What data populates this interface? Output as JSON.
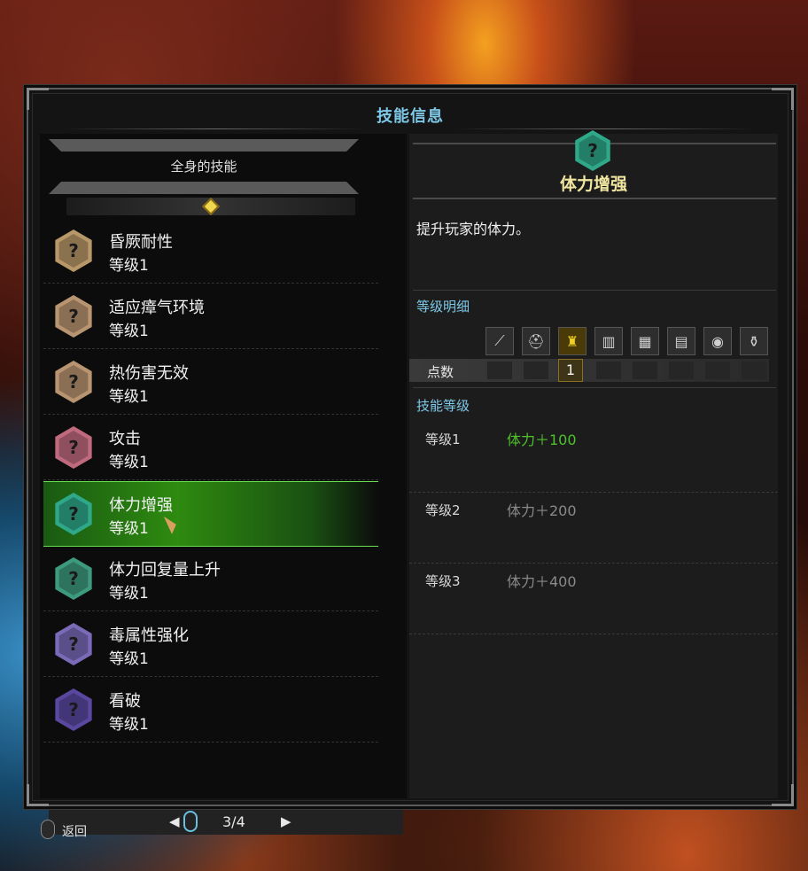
{
  "window": {
    "title": "技能信息"
  },
  "left_panel": {
    "header": "全身的技能",
    "skills": [
      {
        "name": "昏厥耐性",
        "level": "等级1",
        "color": "#b89868"
      },
      {
        "name": "适应瘴气环境",
        "level": "等级1",
        "color": "#b89470"
      },
      {
        "name": "热伤害无效",
        "level": "等级1",
        "color": "#b89470"
      },
      {
        "name": "攻击",
        "level": "等级1",
        "color": "#c06a7e"
      },
      {
        "name": "体力增强",
        "level": "等级1",
        "color": "#2fa88a",
        "selected": true
      },
      {
        "name": "体力回复量上升",
        "level": "等级1",
        "color": "#3e9a7e"
      },
      {
        "name": "毒属性强化",
        "level": "等级1",
        "color": "#7a6ab8"
      },
      {
        "name": "看破",
        "level": "等级1",
        "color": "#5a48a0"
      }
    ],
    "pager": {
      "prev": "◀",
      "next": "▶",
      "page": "3/4"
    }
  },
  "detail": {
    "skill_name": "体力增强",
    "icon_color": "#2fa88a",
    "description": "提升玩家的体力。",
    "level_detail_header": "等级明细",
    "points_label": "点数",
    "points_value": "1",
    "equipment_slots": [
      "weapon-icon",
      "helm-icon",
      "chest-icon",
      "arms-icon",
      "waist-icon",
      "legs-icon",
      "charm-icon",
      "mantle-icon"
    ],
    "active_slot": "chest-icon",
    "skill_levels_header": "技能等级",
    "levels": [
      {
        "label": "等级1",
        "effect": "体力＋100",
        "active": true
      },
      {
        "label": "等级2",
        "effect": "体力＋200",
        "active": false
      },
      {
        "label": "等级3",
        "effect": "体力＋400",
        "active": false
      }
    ]
  },
  "footer": {
    "back_label": "返回"
  }
}
